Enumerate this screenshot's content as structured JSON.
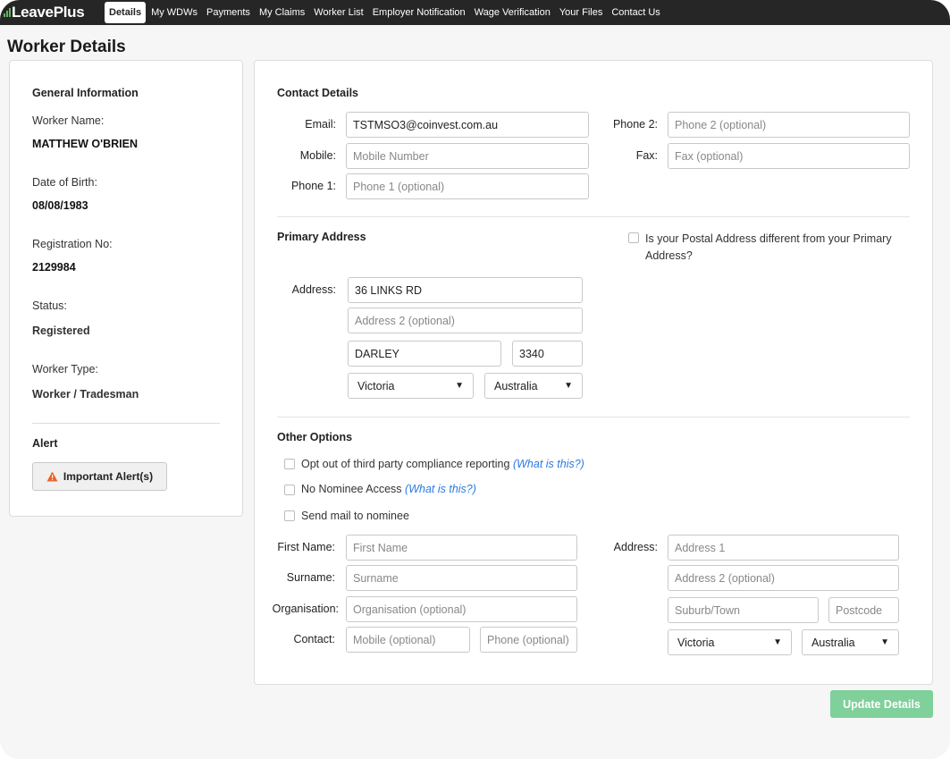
{
  "brand": {
    "logo_text": "LeavePlus",
    "accent": "#5cb85c"
  },
  "nav": {
    "items": [
      {
        "label": "Details",
        "active": true
      },
      {
        "label": "My WDWs"
      },
      {
        "label": "Payments"
      },
      {
        "label": "My Claims"
      },
      {
        "label": "Worker List"
      },
      {
        "label": "Employer Notification"
      },
      {
        "label": "Wage Verification"
      },
      {
        "label": "Your Files"
      },
      {
        "label": "Contact Us"
      }
    ]
  },
  "page": {
    "title": "Worker Details"
  },
  "general": {
    "header": "General Information",
    "worker_name_label": "Worker Name:",
    "worker_name": "MATTHEW O'BRIEN",
    "dob_label": "Date of Birth:",
    "dob": "08/08/1983",
    "reg_label": "Registration No:",
    "reg_no": "2129984",
    "status_label": "Status:",
    "status": "Registered",
    "type_label": "Worker Type:",
    "type": "Worker / Tradesman",
    "alert_header": "Alert",
    "alert_button": "Important Alert(s)",
    "alert_icon": "warning-icon",
    "alert_color": "#e8632b"
  },
  "contact": {
    "header": "Contact Details",
    "email_label": "Email:",
    "email_value": "TSTMSO3@coinvest.com.au",
    "mobile_label": "Mobile:",
    "mobile_placeholder": "Mobile Number",
    "phone1_label": "Phone 1:",
    "phone1_placeholder": "Phone 1 (optional)",
    "phone2_label": "Phone 2:",
    "phone2_placeholder": "Phone 2 (optional)",
    "fax_label": "Fax:",
    "fax_placeholder": "Fax (optional)"
  },
  "primary_address": {
    "header": "Primary Address",
    "postal_diff_line1": "Is your Postal Address different from your Primary",
    "postal_diff_line2": "Address?",
    "address_label": "Address:",
    "address1": "36 LINKS RD",
    "address2_placeholder": "Address 2 (optional)",
    "suburb": "DARLEY",
    "postcode": "3340",
    "state": "Victoria",
    "country": "Australia"
  },
  "other": {
    "header": "Other Options",
    "opt_out_label": "Opt out of third party compliance reporting",
    "what_is_this": "(What is this?)",
    "no_nominee_label": "No Nominee Access",
    "send_mail_label": "Send mail to nominee",
    "first_name_label": "First Name:",
    "first_name_placeholder": "First Name",
    "surname_label": "Surname:",
    "surname_placeholder": "Surname",
    "org_label": "Organisation:",
    "org_placeholder": "Organisation (optional)",
    "contact_label": "Contact:",
    "contact_mobile_placeholder": "Mobile (optional)",
    "contact_phone_placeholder": "Phone (optional)",
    "n_address_label": "Address:",
    "n_address1_placeholder": "Address 1",
    "n_address2_placeholder": "Address 2 (optional)",
    "n_suburb_placeholder": "Suburb/Town",
    "n_postcode_placeholder": "Postcode",
    "n_state": "Victoria",
    "n_country": "Australia"
  },
  "actions": {
    "update_label": "Update Details",
    "update_color": "#7fd09a"
  }
}
